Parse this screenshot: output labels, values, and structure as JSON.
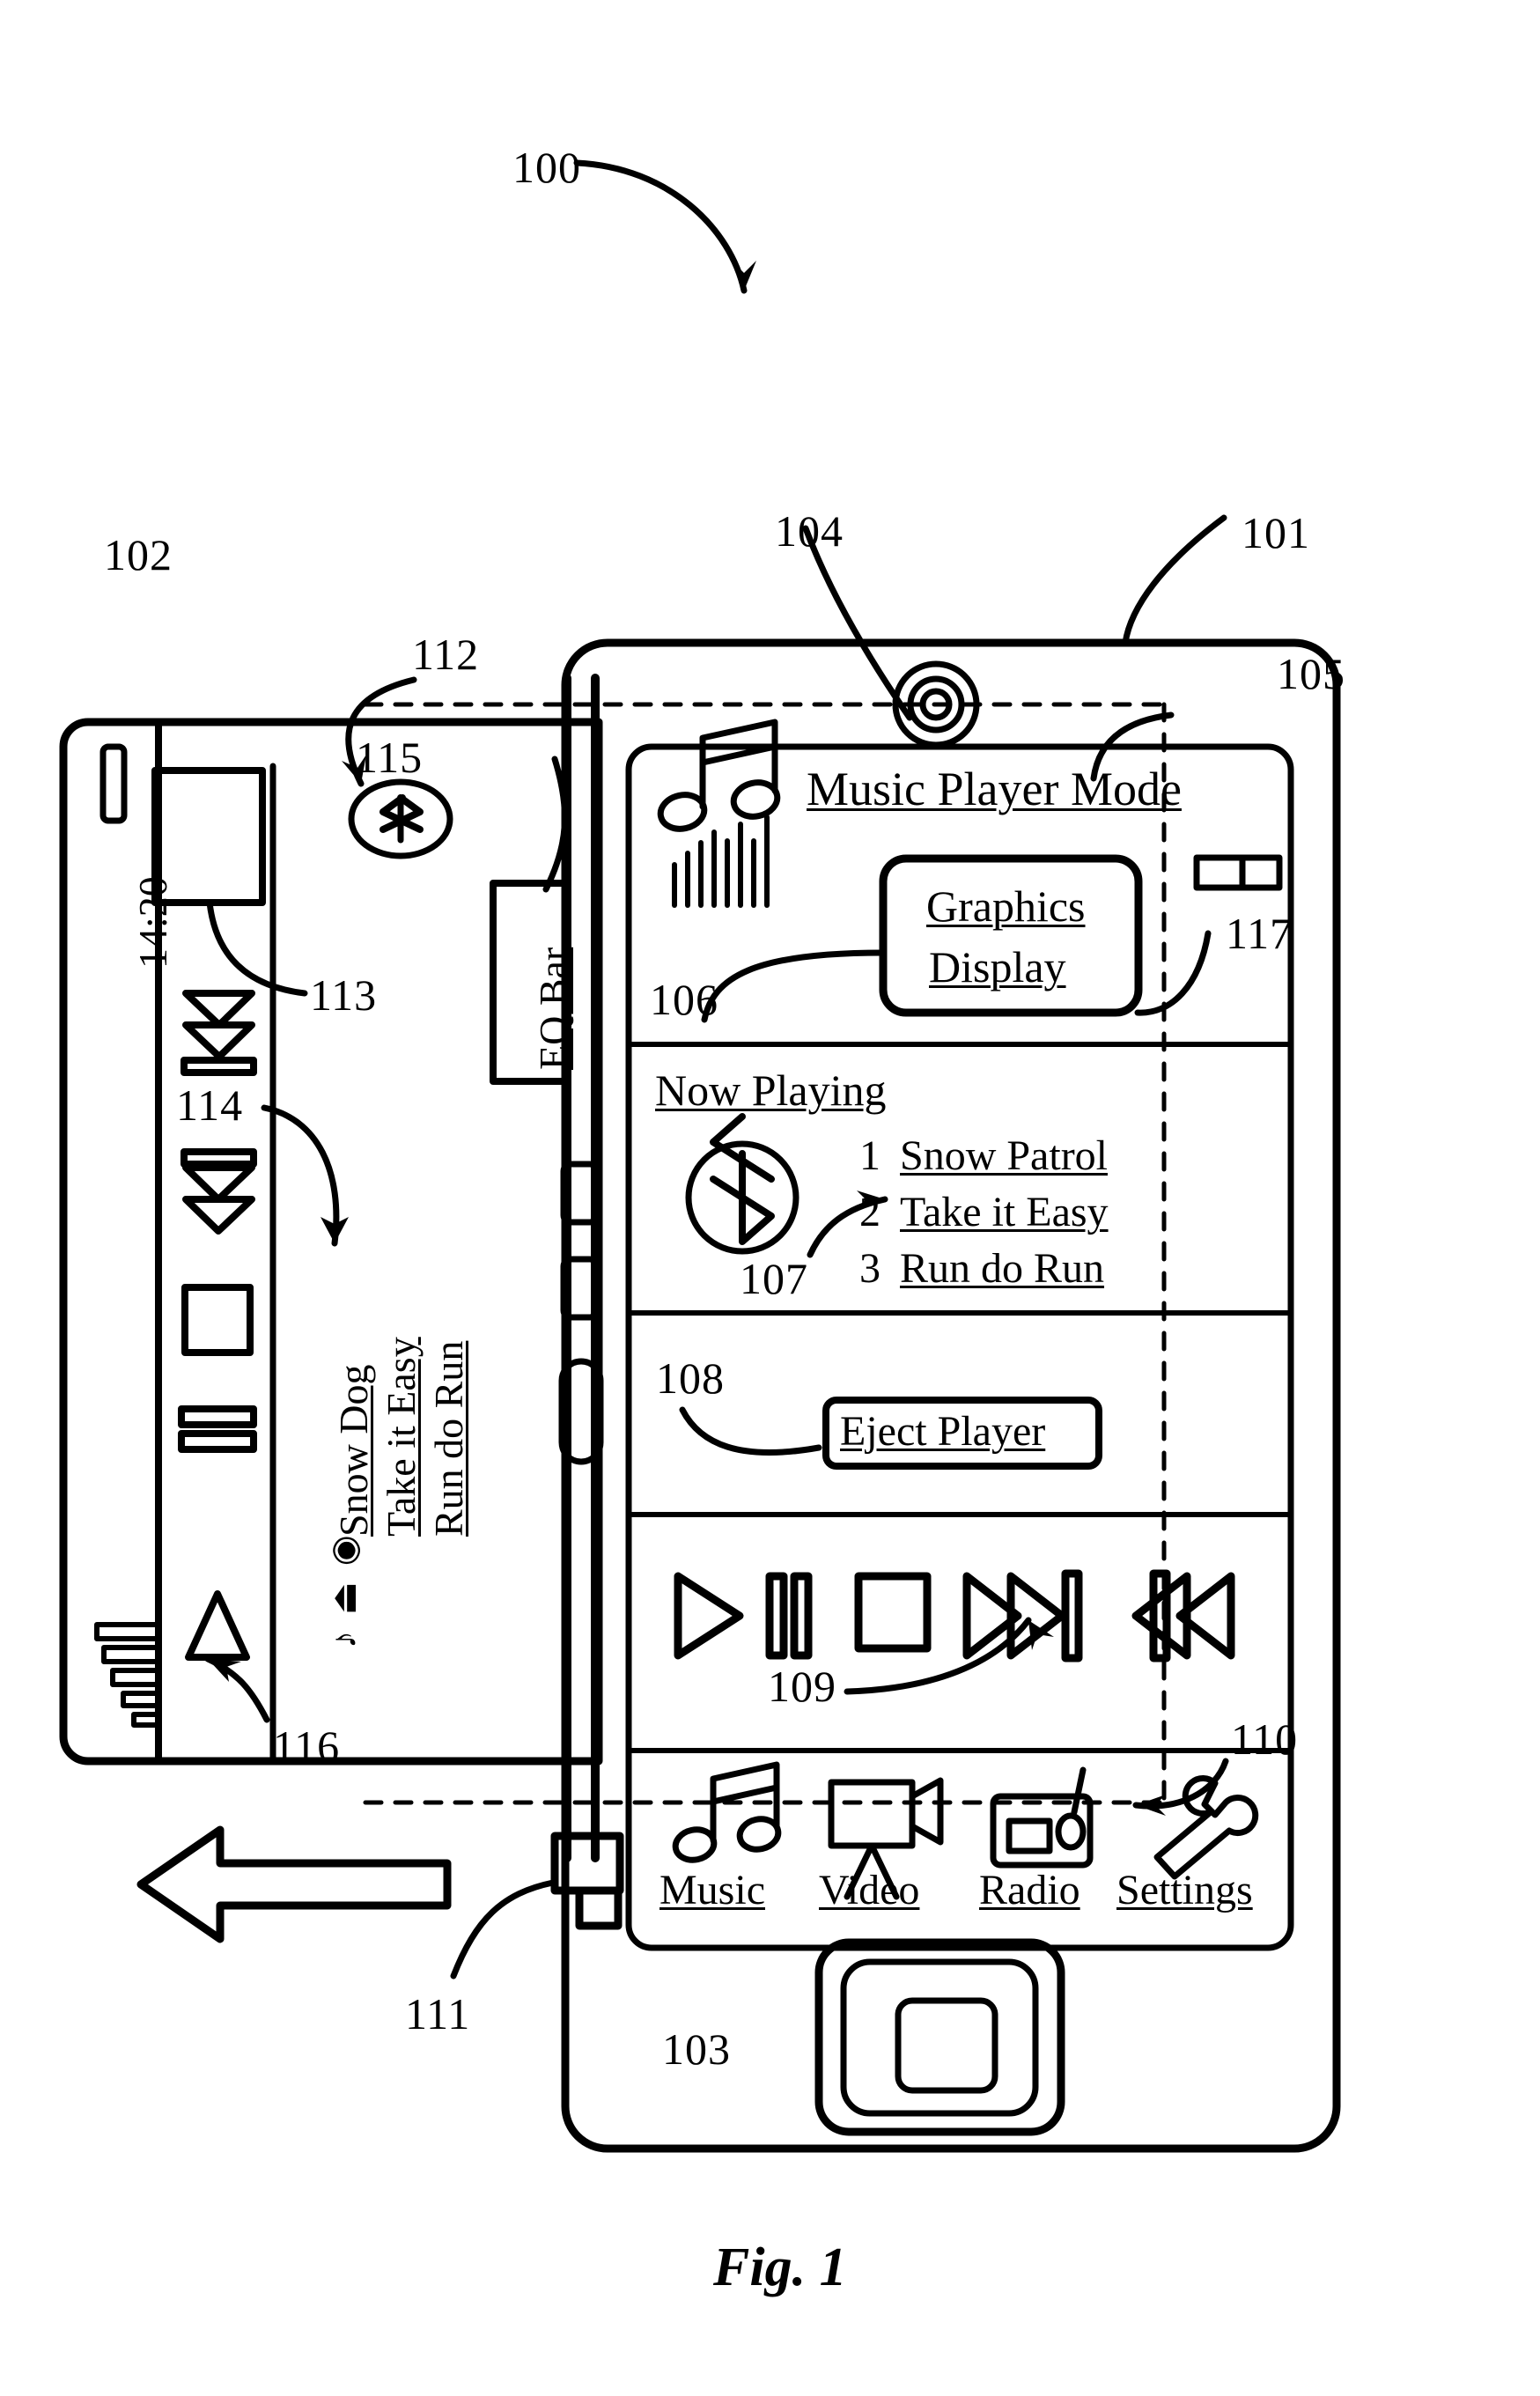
{
  "figure": {
    "caption": "Fig. 1",
    "main_ref": "100"
  },
  "refs": {
    "r100": "100",
    "r101": "101",
    "r102": "102",
    "r103": "103",
    "r104": "104",
    "r105": "105",
    "r106": "106",
    "r107": "107",
    "r108": "108",
    "r109": "109",
    "r110": "110",
    "r111": "111",
    "r112": "112",
    "r113": "113",
    "r114": "114",
    "r115": "115",
    "r116": "116",
    "r117": "117"
  },
  "phone": {
    "screen": {
      "header": {
        "title": "Music Player Mode",
        "music_note_icon": "music-note-icon",
        "equalizer_icon": "equalizer-bars-icon"
      },
      "graphics_display": {
        "line1": "Graphics",
        "line2": "Display"
      },
      "volume_indicator_icon": "volume-slider-icon",
      "now_playing": {
        "title": "Now Playing",
        "bluetooth_icon": "bluetooth-icon",
        "tracks": [
          {
            "number": "1",
            "title": "Snow Patrol"
          },
          {
            "number": "2",
            "title": "Take it Easy"
          },
          {
            "number": "3",
            "title": "Run do Run"
          }
        ]
      },
      "eject": {
        "label": "Eject Player"
      },
      "transport": {
        "buttons": [
          "play-icon",
          "pause-icon",
          "stop-icon",
          "next-track-icon",
          "previous-track-icon"
        ]
      },
      "nav": [
        {
          "label": "Music",
          "icon": "music-note-icon"
        },
        {
          "label": "Video",
          "icon": "video-camera-icon"
        },
        {
          "label": "Radio",
          "icon": "radio-icon"
        },
        {
          "label": "Settings",
          "icon": "wrench-icon"
        }
      ]
    },
    "home_button_icon": "home-button-icon",
    "camera_icon": "camera-speaker-icon"
  },
  "player": {
    "status_time": "14:20",
    "speaker_icon": "speaker-slot-icon",
    "bluetooth_badge_icon": "bluetooth-badge-icon",
    "eq_bar_label": "EQ Bar",
    "tracks": [
      "Snow Dog",
      "Take it Easy",
      "Run do Run"
    ],
    "small_icons": [
      "music-note-icon",
      "eject-icon",
      "record-icon"
    ],
    "side_buttons": [
      "eject-button-icon",
      "load-button-icon",
      "stop-button-icon",
      "pause-button-icon",
      "play-triangle-icon"
    ],
    "signal_bars_icon": "signal-bars-icon",
    "slide_arrow_icon": "slide-out-arrow-icon"
  }
}
